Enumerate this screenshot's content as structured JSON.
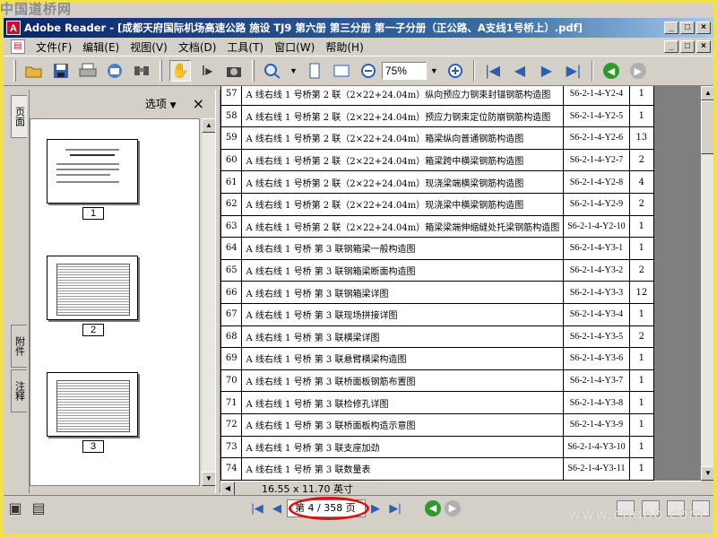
{
  "watermark": "中国道桥网",
  "window": {
    "title": "Adobe Reader - [成都天府国际机场高速公路 施设 TJ9 第六册 第三分册 第一子分册（正公路、A支线1号桥上）.pdf]",
    "controls": [
      "_",
      "□",
      "×"
    ]
  },
  "menu": {
    "items": [
      "文件(F)",
      "编辑(E)",
      "视图(V)",
      "文档(D)",
      "工具(T)",
      "窗口(W)",
      "帮助(H)"
    ]
  },
  "toolbar": {
    "zoom": "75%",
    "icons": [
      "open-icon",
      "save-icon",
      "print-icon",
      "email-icon",
      "search-icon",
      "hand-icon",
      "select-text-icon",
      "snapshot-icon",
      "zoom-in-icon",
      "fit-page-icon",
      "fit-width-icon",
      "zoom-out-icon",
      "first-page-icon",
      "prev-page-icon",
      "next-page-icon",
      "last-page-icon",
      "go-back-icon",
      "go-forward-icon"
    ]
  },
  "side_tabs": [
    "页面",
    "附件",
    "注释"
  ],
  "panel": {
    "options_label": "选项",
    "close": "×",
    "pages": [
      "1",
      "2",
      "3"
    ]
  },
  "table": {
    "rows": [
      {
        "n": "57",
        "desc": "A 线右线 1 号桥第 2 联（2×22+24.04m）纵向预应力钢束封锚钢筋构造图",
        "code": "S6-2-1-4-Y2-4",
        "qty": "1"
      },
      {
        "n": "58",
        "desc": "A 线右线 1 号桥第 2 联（2×22+24.04m）预应力钢束定位防崩钢筋构造图",
        "code": "S6-2-1-4-Y2-5",
        "qty": "1"
      },
      {
        "n": "59",
        "desc": "A 线右线 1 号桥第 2 联（2×22+24.04m）箱梁纵向普通钢筋构造图",
        "code": "S6-2-1-4-Y2-6",
        "qty": "13"
      },
      {
        "n": "60",
        "desc": "A 线右线 1 号桥第 2 联（2×22+24.04m）箱梁跨中横梁钢筋构造图",
        "code": "S6-2-1-4-Y2-7",
        "qty": "2"
      },
      {
        "n": "61",
        "desc": "A 线右线 1 号桥第 2 联（2×22+24.04m）现浇梁端横梁钢筋构造图",
        "code": "S6-2-1-4-Y2-8",
        "qty": "4"
      },
      {
        "n": "62",
        "desc": "A 线右线 1 号桥第 2 联（2×22+24.04m）现浇梁中横梁钢筋构造图",
        "code": "S6-2-1-4-Y2-9",
        "qty": "2"
      },
      {
        "n": "63",
        "desc": "A 线右线 1 号桥第 2 联（2×22+24.04m）箱梁梁端伸缩缝处托梁钢筋构造图",
        "code": "S6-2-1-4-Y2-10",
        "qty": "1"
      },
      {
        "n": "64",
        "desc": "A 线右线 1 号桥 第 3 联钢箱梁一般构造图",
        "code": "S6-2-1-4-Y3-1",
        "qty": "1"
      },
      {
        "n": "65",
        "desc": "A 线右线 1 号桥 第 3 联钢箱梁断面构造图",
        "code": "S6-2-1-4-Y3-2",
        "qty": "2"
      },
      {
        "n": "66",
        "desc": "A 线右线 1 号桥 第 3 联钢箱梁详图",
        "code": "S6-2-1-4-Y3-3",
        "qty": "12"
      },
      {
        "n": "67",
        "desc": "A 线右线 1 号桥 第 3 联现场拼接详图",
        "code": "S6-2-1-4-Y3-4",
        "qty": "1"
      },
      {
        "n": "68",
        "desc": "A 线右线 1 号桥 第 3 联横梁详图",
        "code": "S6-2-1-4-Y3-5",
        "qty": "2"
      },
      {
        "n": "69",
        "desc": "A 线右线 1 号桥 第 3 联悬臂横梁构造图",
        "code": "S6-2-1-4-Y3-6",
        "qty": "1"
      },
      {
        "n": "70",
        "desc": "A 线右线 1 号桥 第 3 联桥面板钢筋布置图",
        "code": "S6-2-1-4-Y3-7",
        "qty": "1"
      },
      {
        "n": "71",
        "desc": "A 线右线 1 号桥 第 3 联检修孔详图",
        "code": "S6-2-1-4-Y3-8",
        "qty": "1"
      },
      {
        "n": "72",
        "desc": "A 线右线 1 号桥 第 3 联桥面板构造示意图",
        "code": "S6-2-1-4-Y3-9",
        "qty": "1"
      },
      {
        "n": "73",
        "desc": "A 线右线 1 号桥 第 3 联支座加劲",
        "code": "S6-2-1-4-Y3-10",
        "qty": "1"
      },
      {
        "n": "74",
        "desc": "A 线右线 1 号桥 第 3 联数量表",
        "code": "S6-2-1-4-Y3-11",
        "qty": "1"
      }
    ]
  },
  "status": {
    "page_size": "16.55 x 11.70 英寸",
    "page_indicator": "第 4 / 358 页"
  },
  "site_watermark": "www.cndao.com",
  "colors": {
    "highlight_ring": "#e01010",
    "title_gradient_start": "#0a246a",
    "background": "#f2e24a"
  }
}
